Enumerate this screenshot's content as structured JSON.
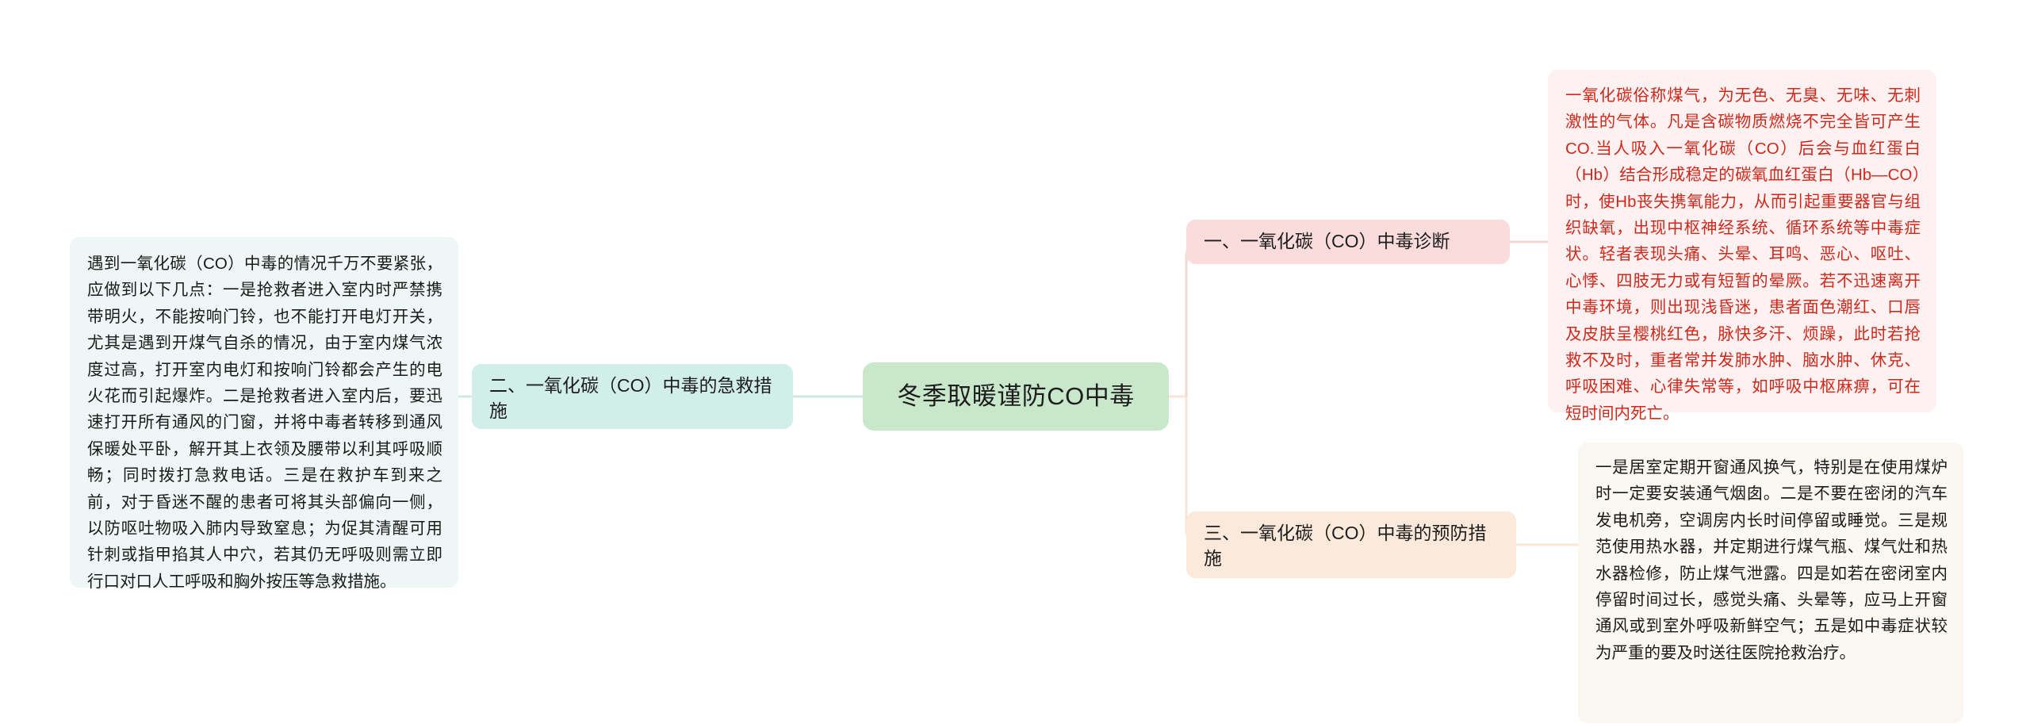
{
  "map": {
    "title": "冬季取暖谨防CO中毒",
    "colors": {
      "central_bg": "#c9e8cb",
      "branch_left_bg": "#d2eee9",
      "branch_right_top_bg": "#fadcdc",
      "branch_right_bottom_bg": "#fbeadb",
      "detail_left_bg": "#eef7f6",
      "detail_right_top_bg": "#fdf1f1",
      "detail_right_bottom_bg": "#fbf7f1",
      "link_teal": "#cfe9e3",
      "link_pink": "#f3d7d7",
      "link_peach": "#f8e5d3",
      "detail_right_top_text": "#d0291c",
      "text_dark": "#1a1a1a"
    }
  },
  "central": {
    "label": "冬季取暖谨防CO中毒"
  },
  "branches": {
    "diagnosis": {
      "label": "一、一氧化碳（CO）中毒诊断",
      "detail": "一氧化碳俗称煤气，为无色、无臭、无味、无刺激性的气体。凡是含碳物质燃烧不完全皆可产生CO.当人吸入一氧化碳（CO）后会与血红蛋白（Hb）结合形成稳定的碳氧血红蛋白（Hb—CO）时，使Hb丧失携氧能力，从而引起重要器官与组织缺氧，出现中枢神经系统、循环系统等中毒症状。轻者表现头痛、头晕、耳鸣、恶心、呕吐、心悸、四肢无力或有短暂的晕厥。若不迅速离开中毒环境，则出现浅昏迷，患者面色潮红、口唇及皮肤呈樱桃红色，脉快多汗、烦躁，此时若抢救不及时，重者常并发肺水肿、脑水肿、休克、呼吸困难、心律失常等，如呼吸中枢麻痹，可在短时间内死亡。"
    },
    "first_aid": {
      "label": "二、一氧化碳（CO）中毒的急救措施",
      "detail": "遇到一氧化碳（CO）中毒的情况千万不要紧张，应做到以下几点：一是抢救者进入室内时严禁携带明火，不能按响门铃，也不能打开电灯开关，尤其是遇到开煤气自杀的情况，由于室内煤气浓度过高，打开室内电灯和按响门铃都会产生的电火花而引起爆炸。二是抢救者进入室内后，要迅速打开所有通风的门窗，并将中毒者转移到通风保暖处平卧，解开其上衣领及腰带以利其呼吸顺畅；同时拨打急救电话。三是在救护车到来之前，对于昏迷不醒的患者可将其头部偏向一侧，以防呕吐物吸入肺内导致窒息；为促其清醒可用针刺或指甲掐其人中穴，若其仍无呼吸则需立即行口对口人工呼吸和胸外按压等急救措施。"
    },
    "prevention": {
      "label": "三、一氧化碳（CO）中毒的预防措施",
      "detail": "一是居室定期开窗通风换气，特别是在使用煤炉时一定要安装通气烟囱。二是不要在密闭的汽车发电机旁，空调房内长时间停留或睡觉。三是规范使用热水器，并定期进行煤气瓶、煤气灶和热水器检修，防止煤气泄露。四是如若在密闭室内停留时间过长，感觉头痛、头晕等，应马上开窗通风或到室外呼吸新鲜空气；五是如中毒症状较为严重的要及时送往医院抢救治疗。"
    }
  }
}
